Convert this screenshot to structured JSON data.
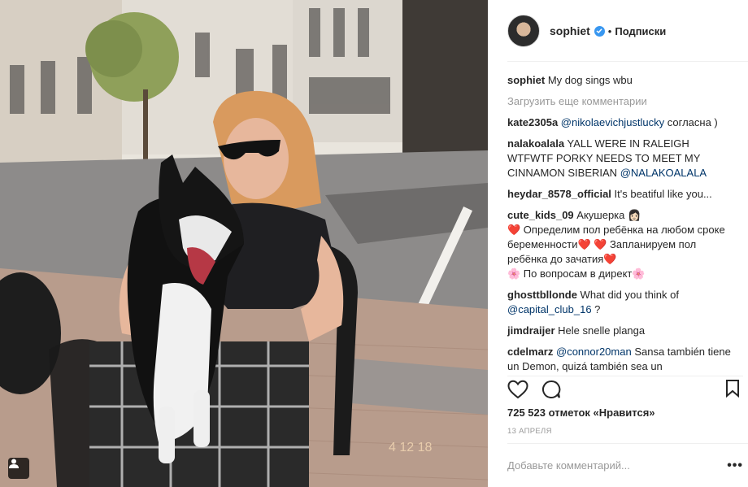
{
  "photo": {
    "alt_icon": "user-tag-icon",
    "watermark": "4 12 18"
  },
  "header": {
    "username": "sophiet",
    "separator": "•",
    "follow_label": "Подписки"
  },
  "caption": {
    "username": "sophiet",
    "text": " My dog sings wbu"
  },
  "load_more_label": "Загрузить еще комментарии",
  "comments": [
    {
      "user": "kate2305a",
      "mention": "@nikolaevichjustlucky",
      "text": " согласна )"
    },
    {
      "user": "nalakoalala",
      "text": " YALL WERE IN RALEIGH WTFWTF PORKY NEEDS TO MEET MY CINNAMON SIBERIAN ",
      "mention": "@NALAKOALALA"
    },
    {
      "user": "heydar_8578_official",
      "text": " It's beatiful like you..."
    },
    {
      "user": "cute_kids_09",
      "text": " Акушерка 👩🏻"
    },
    {
      "text": "❤️ Определим пол ребёнка на любом сроке беременности❤️ ❤️ Запланируем пол ребёнка до зачатия❤️"
    },
    {
      "text": "🌸 По вопросам в директ🌸"
    },
    {
      "user": "ghosttbllonde",
      "text": " What did you think of ",
      "mention": "@capital_club_16",
      "tail": " ?"
    },
    {
      "user": "jimdraijer",
      "text": " Hele snelle planga"
    },
    {
      "user": "cdelmarz",
      "mention": "@connor20man",
      "text": " Sansa también tiene un Demon, quizá también sea un"
    }
  ],
  "likes_text": "725 523 отметок «Нравится»",
  "date_text": "13 апреля",
  "add_comment_placeholder": "Добавьте комментарий...",
  "more_label": "•••",
  "colors": {
    "link": "#003569",
    "verified": "#3897f0",
    "muted": "#999999",
    "divider": "#efefef"
  }
}
